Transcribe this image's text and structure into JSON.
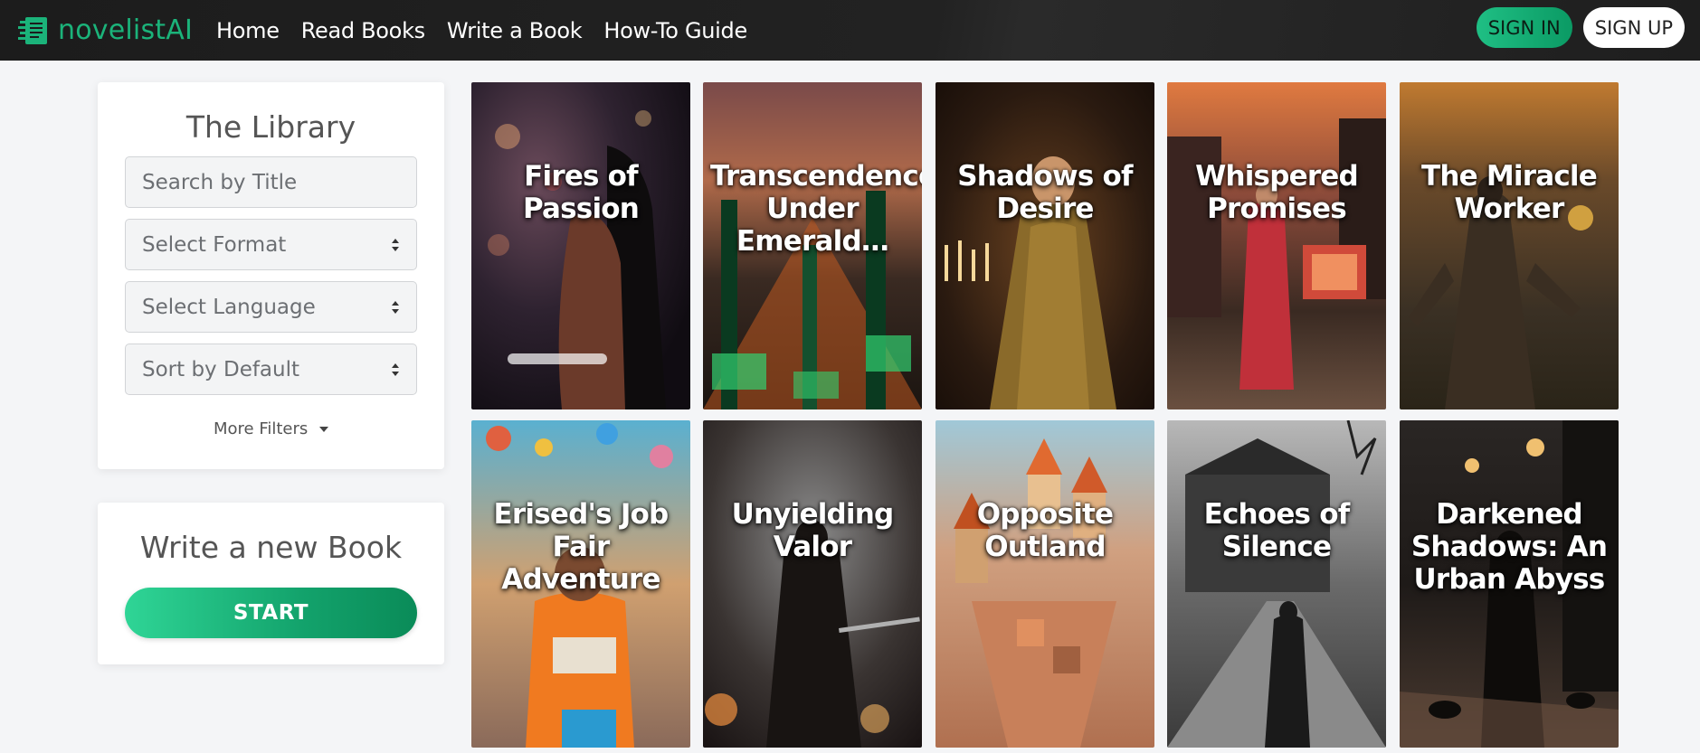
{
  "brand": {
    "name": "novelistAI",
    "color": "#1bb37a"
  },
  "nav": {
    "links": [
      "Home",
      "Read Books",
      "Write a Book",
      "How-To Guide"
    ],
    "sign_in": "SIGN IN",
    "sign_up": "SIGN UP"
  },
  "library": {
    "title": "The Library",
    "search_placeholder": "Search by Title",
    "format_select": "Select Format",
    "language_select": "Select Language",
    "sort_select": "Sort by Default",
    "more_filters": "More Filters"
  },
  "write": {
    "title": "Write a new Book",
    "start": "START"
  },
  "books": [
    {
      "title": "Fires of Passion",
      "theme": "romance-night"
    },
    {
      "title": "Transcendence: Under Emerald…",
      "theme": "emerald-city"
    },
    {
      "title": "Shadows of Desire",
      "theme": "candlelight-gown"
    },
    {
      "title": "Whispered Promises",
      "theme": "sunset-painter"
    },
    {
      "title": "The Miracle Worker",
      "theme": "robed-figure"
    },
    {
      "title": "Erised's Job Fair Adventure",
      "theme": "colorful-fair"
    },
    {
      "title": "Unyielding Valor",
      "theme": "dark-knight"
    },
    {
      "title": "Opposite Outland",
      "theme": "whimsical-town"
    },
    {
      "title": "Echoes of Silence",
      "theme": "misty-road"
    },
    {
      "title": "Darkened Shadows: An Urban Abyss",
      "theme": "rainy-street"
    }
  ]
}
